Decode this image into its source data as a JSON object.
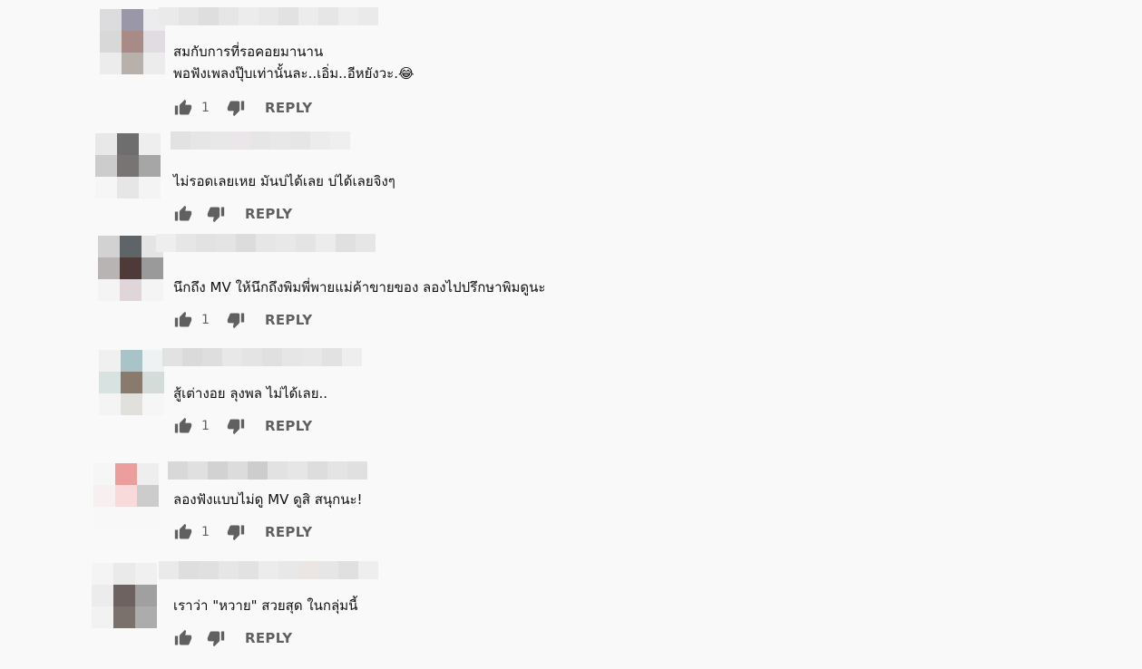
{
  "comments": [
    {
      "lines": [
        "สมกับการที่รอคอยมานาน",
        "พอฟังเพลงปุ๊บเท่านั้นละ..เอิ่ม..อีหยังวะ.😂"
      ],
      "likes": "1",
      "reply_label": "REPLY",
      "avatar_colors": [
        "#dcdcde",
        "#9a98a8",
        "#ececee",
        "#d8d8d8",
        "#a88a86",
        "#e0dce2",
        "#ececec",
        "#b8b0aa",
        "#ececec"
      ],
      "author_colors": [
        "#eaeaea",
        "#e4e4e4",
        "#dedede",
        "#e6e6e6",
        "#ececec",
        "#e8e8e8",
        "#e2e2e2",
        "#ececec",
        "#e6e6e6",
        "#eeeeee",
        "#eaeaea"
      ]
    },
    {
      "lines": [
        "ไม่รอดเลยเหย มันบ่ได้เลย บ่ได้เลยจิงๆ"
      ],
      "likes": "",
      "reply_label": "REPLY",
      "avatar_colors": [
        "#e8e8e8",
        "#6e6e6e",
        "#eeeeee",
        "#cccccc",
        "#787474",
        "#a6a6a6",
        "#f6f6f6",
        "#e6e6e6",
        "#f4f4f4"
      ],
      "author_colors": [
        "#e2e2e2",
        "#e6e6e6",
        "#e8e8e8",
        "#ebe6ea",
        "#e6e6e6",
        "#e8e8e8",
        "#e6e6e6",
        "#ececec",
        "#efefef"
      ]
    },
    {
      "lines": [
        "นึกถึง MV ให้นึกถึงพิมพี่พายแม่ค้าขายของ ลองไปปรึกษาพิมดูนะ"
      ],
      "likes": "1",
      "reply_label": "REPLY",
      "avatar_colors": [
        "#d2d2d2",
        "#5e6468",
        "#e4e4e4",
        "#b8b4b4",
        "#4e3a38",
        "#9a9a9a",
        "#f4f4f4",
        "#e0d6da",
        "#f4f4f4"
      ],
      "author_colors": [
        "#eeeeee",
        "#e6e6e6",
        "#e2e2e2",
        "#e4e4e4",
        "#dcdcdc",
        "#e6e6e6",
        "#e8e8e8",
        "#e4e4e4",
        "#ececec",
        "#e0e0e0",
        "#e6e6e6"
      ]
    },
    {
      "lines": [
        "สู้เต่างอย ลุงพล ไม่ได้เลย.."
      ],
      "likes": "1",
      "reply_label": "REPLY",
      "avatar_colors": [
        "#f0f0f0",
        "#a8c4c8",
        "#eef2f2",
        "#d8e2e0",
        "#8a7a6e",
        "#d4dcda",
        "#f4f4f4",
        "#e2e0dc",
        "#f6f6f6"
      ],
      "author_colors": [
        "#e2e2e2",
        "#dadada",
        "#dedede",
        "#e8e8e8",
        "#e4e4e4",
        "#e0e0e0",
        "#e6e6e6",
        "#e8e8e8",
        "#e2e2e2",
        "#eeeeee"
      ]
    },
    {
      "lines": [
        "ลองฟังแบบไม่ดู MV ดูสิ สนุกนะ!"
      ],
      "likes": "1",
      "reply_label": "REPLY",
      "avatar_colors": [
        "#f6f6f6",
        "#ec9e9c",
        "#eeeeee",
        "#f8f0f0",
        "#f8dada",
        "#cccccc",
        "#f8f8f8",
        "#f8f8f8",
        "#f8f8f8"
      ],
      "author_colors": [
        "#d8d8d8",
        "#e0e0e0",
        "#d2d2d2",
        "#dcdcdc",
        "#cdcdcd",
        "#e2e2e2",
        "#e6e6e6",
        "#dddddd",
        "#e4e4e4",
        "#e0e0e0"
      ]
    },
    {
      "lines": [
        "เราว่า \"หวาย\" สวยสุด ในกลุ่มนี้"
      ],
      "likes": "",
      "reply_label": "REPLY",
      "avatar_colors": [
        "#f4f4f4",
        "#eaeaea",
        "#f0f0f0",
        "#ececec",
        "#6e6260",
        "#a0a0a0",
        "#f2f2f2",
        "#7a706c",
        "#acacac"
      ],
      "author_colors": [
        "#eaeaea",
        "#dedede",
        "#e0e0e0",
        "#e6e6e6",
        "#e2e2e2",
        "#ececec",
        "#e8e8e8",
        "#ebe6e4",
        "#e6e6e6",
        "#e0e0e0",
        "#eeeeee"
      ]
    }
  ]
}
